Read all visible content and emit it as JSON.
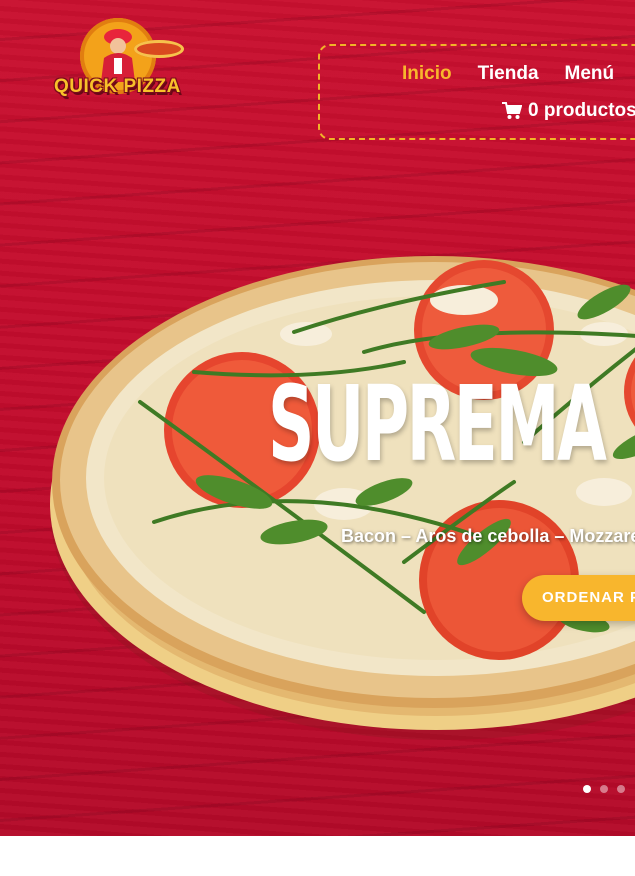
{
  "brand": {
    "logo_text": "QUICK PIZZA"
  },
  "nav": {
    "items": [
      {
        "label": "Inicio",
        "active": true
      },
      {
        "label": "Tienda",
        "active": false
      },
      {
        "label": "Menú",
        "active": false
      }
    ],
    "cart_label": "0 productos",
    "cart_icon": "shopping-cart-icon"
  },
  "hero": {
    "title": "SUPREMA",
    "subtitle": "Bacon – Aros de cebolla – Mozzarella",
    "cta_label": "ORDENAR PIZZA",
    "slides_total": 3,
    "active_slide": 1
  },
  "colors": {
    "hero_background": "#c20b2e",
    "accent": "#f8b62d",
    "nav_text": "#ffffff"
  }
}
